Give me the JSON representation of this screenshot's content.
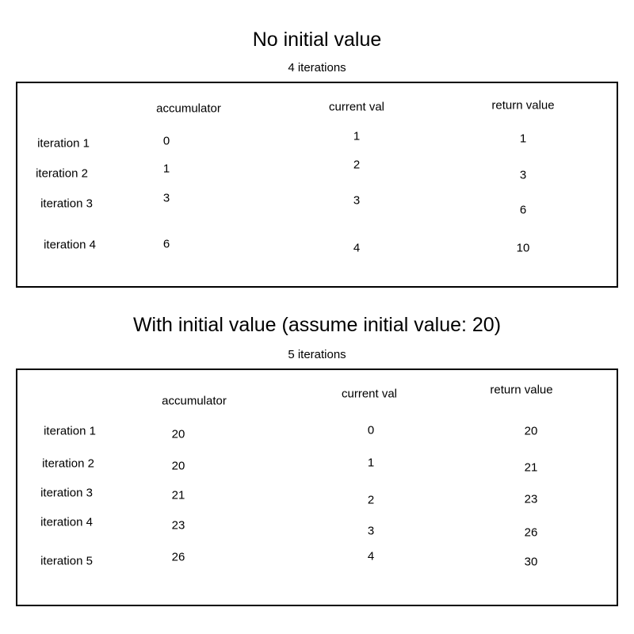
{
  "page": {
    "background": "#ffffff",
    "text_color": "#000000",
    "border_color": "#000000"
  },
  "sections": [
    {
      "id": "no-initial-value",
      "title": "No initial value",
      "subtitle": "4 iterations",
      "columns": [
        "accumulator",
        "current val",
        "return value"
      ],
      "rows": [
        {
          "label": "iteration 1",
          "accumulator": "0",
          "current_val": "1",
          "return_value": "1"
        },
        {
          "label": "iteration 2",
          "accumulator": "1",
          "current_val": "2",
          "return_value": "3"
        },
        {
          "label": "iteration 3",
          "accumulator": "3",
          "current_val": "3",
          "return_value": "6"
        },
        {
          "label": "iteration 4",
          "accumulator": "6",
          "current_val": "4",
          "return_value": "10"
        }
      ]
    },
    {
      "id": "with-initial-value",
      "title": "With initial value (assume initial value: 20)",
      "subtitle": "5 iterations",
      "columns": [
        "accumulator",
        "current val",
        "return value"
      ],
      "rows": [
        {
          "label": "iteration 1",
          "accumulator": "20",
          "current_val": "0",
          "return_value": "20"
        },
        {
          "label": "iteration 2",
          "accumulator": "20",
          "current_val": "1",
          "return_value": "21"
        },
        {
          "label": "iteration 3",
          "accumulator": "21",
          "current_val": "2",
          "return_value": "23"
        },
        {
          "label": "iteration 4",
          "accumulator": "23",
          "current_val": "3",
          "return_value": "26"
        },
        {
          "label": "iteration 5",
          "accumulator": "26",
          "current_val": "4",
          "return_value": "30"
        }
      ]
    }
  ]
}
